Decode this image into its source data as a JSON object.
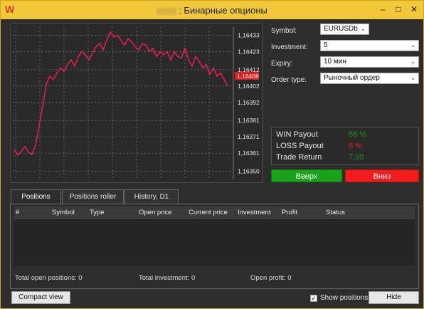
{
  "window": {
    "title": ": Бинарные опционы",
    "minimize_glyph": "–",
    "maximize_glyph": "□",
    "close_glyph": "✕"
  },
  "chart_data": {
    "type": "line",
    "y_ticks": [
      "1,16433",
      "1,16423",
      "1,16412",
      "1,16402",
      "1,16392",
      "1,16381",
      "1,16371",
      "1,16361",
      "1,16350"
    ],
    "ylim": [
      1.16345,
      1.16438
    ],
    "current_price_label": "1,16408",
    "current_price": 1.16408,
    "grid": true,
    "line_color": "#e0204a",
    "values": [
      1.16363,
      1.1636,
      1.16362,
      1.16365,
      1.16362,
      1.1636,
      1.16366,
      1.16378,
      1.1639,
      1.16403,
      1.16408,
      1.16406,
      1.1641,
      1.16413,
      1.16411,
      1.16415,
      1.16418,
      1.16414,
      1.1642,
      1.16423,
      1.16421,
      1.16418,
      1.16422,
      1.16426,
      1.16428,
      1.16424,
      1.1643,
      1.16435,
      1.16432,
      1.16433,
      1.1643,
      1.16427,
      1.16431,
      1.16429,
      1.16426,
      1.16424,
      1.16428,
      1.16427,
      1.16423,
      1.16425,
      1.1642,
      1.16423,
      1.16421,
      1.16423,
      1.16418,
      1.16423,
      1.1642,
      1.16419,
      1.16425,
      1.16418,
      1.16414,
      1.1642,
      1.16417,
      1.16413,
      1.16415,
      1.16409,
      1.16413,
      1.16408,
      1.1641,
      1.16406,
      1.16402
    ]
  },
  "form": {
    "symbol_label": "Symbol:",
    "symbol_value": "EURUSDb",
    "investment_label": "Investment:",
    "investment_value": "5",
    "expiry_label": "Expiry:",
    "expiry_value": "10 мин",
    "order_type_label": "Order type:",
    "order_type_value": "Рыночный ордер"
  },
  "payout": {
    "win_label": "WIN Payout",
    "win_value": "58 %",
    "loss_label": "LOSS Payout",
    "loss_value": "8 %",
    "return_label": "Trade Return",
    "return_value": "7,90",
    "win_color": "#1f8f1f",
    "loss_color": "#e01b1b",
    "return_color": "#1f8f1f"
  },
  "actions": {
    "up_label": "Вверх",
    "down_label": "Вниз"
  },
  "tabs": [
    {
      "label": "Positions"
    },
    {
      "label": "Positions roller"
    },
    {
      "label": "History, D1"
    }
  ],
  "table": {
    "columns": [
      "#",
      "Symbol",
      "Type",
      "Open price",
      "Current price",
      "Investment",
      "Profit",
      "Status"
    ]
  },
  "summary": {
    "total_open_positions_label": "Total open positions:",
    "total_open_positions_value": "0",
    "total_investment_label": "Total investment:",
    "total_investment_value": "0",
    "open_profit_label": "Open profit:",
    "open_profit_value": "0"
  },
  "footer": {
    "compact_view_label": "Compact view",
    "show_positions_label": "Show positions",
    "show_positions_checked": true,
    "hide_label": "Hide"
  }
}
